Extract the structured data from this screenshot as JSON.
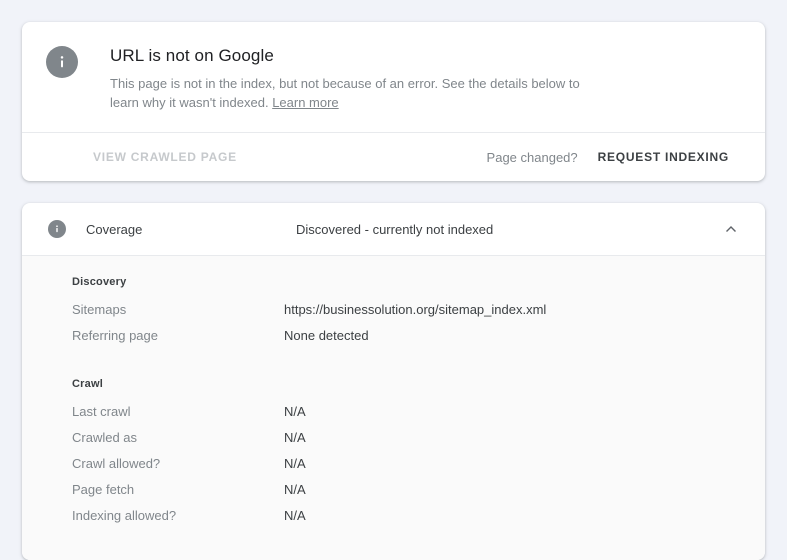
{
  "status_card": {
    "icon": "info-icon",
    "title": "URL is not on Google",
    "description": "This page is not in the index, but not because of an error. See the details below to learn why it wasn't indexed. ",
    "learn_more_label": "Learn more",
    "view_crawled_page_label": "VIEW CRAWLED PAGE",
    "page_changed_label": "Page changed?",
    "request_indexing_label": "REQUEST INDEXING"
  },
  "coverage_card": {
    "icon": "info-icon",
    "title": "Coverage",
    "status": "Discovered - currently not indexed",
    "collapse_icon": "chevron-up-icon",
    "groups": [
      {
        "heading": "Discovery",
        "rows": [
          {
            "label": "Sitemaps",
            "value": "https://businessolution.org/sitemap_index.xml"
          },
          {
            "label": "Referring page",
            "value": "None detected"
          }
        ]
      },
      {
        "heading": "Crawl",
        "rows": [
          {
            "label": "Last crawl",
            "value": "N/A"
          },
          {
            "label": "Crawled as",
            "value": "N/A"
          },
          {
            "label": "Crawl allowed?",
            "value": "N/A"
          },
          {
            "label": "Page fetch",
            "value": "N/A"
          },
          {
            "label": "Indexing allowed?",
            "value": "N/A"
          }
        ]
      }
    ]
  },
  "colors": {
    "page_background": "#f1f3f9",
    "card_background": "#ffffff",
    "detail_background": "#fafafa",
    "icon_grey": "#80868b",
    "text_primary": "#3c4043",
    "text_secondary": "#80868b",
    "divider": "#e8eaed"
  }
}
